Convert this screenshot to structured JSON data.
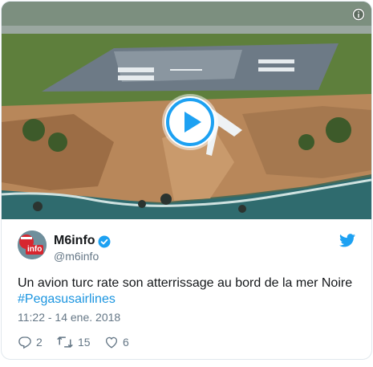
{
  "media": {
    "icons": {
      "info": "info-icon",
      "play": "play-icon"
    },
    "colors": {
      "sea": "#2f6b6e",
      "cliff": "#b8875a",
      "grass": "#5e7f3c",
      "runway": "#6d7a86"
    }
  },
  "tweet": {
    "author_name": "M6info",
    "author_handle": "@m6info",
    "avatar_logo_text": "info",
    "text_main": "Un avion turc rate son atterrissage au bord de la mer Noire",
    "hashtag": "#Pegasusairlines",
    "timestamp": "11:22 - 14 ene. 2018",
    "replies": "2",
    "retweets": "15",
    "likes": "6",
    "icons": {
      "verified": "verified-badge-icon",
      "bird": "twitter-bird-icon",
      "reply": "reply-icon",
      "retweet": "retweet-icon",
      "like": "heart-icon"
    },
    "colors": {
      "accent": "#1da1f2",
      "link": "#1b95e0",
      "muted": "#657786"
    }
  }
}
